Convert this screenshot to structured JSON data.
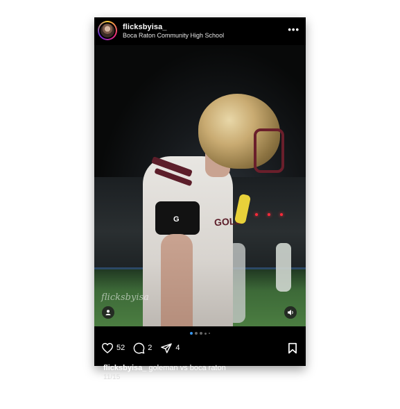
{
  "post": {
    "username": "flicksbyisa_",
    "location": "Boca Raton Community High School",
    "more_label": "•••",
    "watermark": "flicksbyisa",
    "jersey_text": "GOLE",
    "sleeve_logo": "G",
    "likes": "52",
    "comments": "2",
    "shares": "4",
    "caption_user": "flicksbyisa_",
    "caption_text": "goleman vs boca raton",
    "date": "11/15",
    "carousel": {
      "count": 5,
      "active": 0
    }
  },
  "icons": {
    "tag": "user-tag-icon",
    "audio": "volume-icon",
    "like": "heart-icon",
    "comment": "comment-icon",
    "share": "send-icon",
    "save": "bookmark-icon"
  },
  "colors": {
    "background": "#000000",
    "accent_dot": "#3897f0",
    "jersey_maroon": "#5c1e2a",
    "helmet_gold": "#c9ab72"
  }
}
